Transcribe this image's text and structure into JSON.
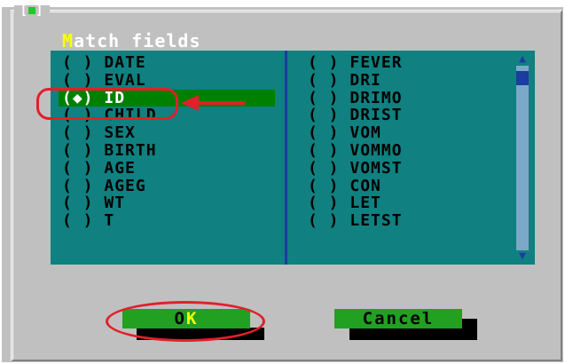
{
  "dialog": {
    "close_box_left": "[",
    "close_box_right": "]",
    "title_hotkey": "M",
    "title_rest": "atch fields"
  },
  "fields_left": [
    {
      "marker": "( )",
      "name": "DATE",
      "selected": false
    },
    {
      "marker": "( )",
      "name": "EVAL",
      "selected": false
    },
    {
      "marker": "(◆)",
      "name": "ID",
      "selected": true
    },
    {
      "marker": "( )",
      "name": "CHILD",
      "selected": false
    },
    {
      "marker": "( )",
      "name": "SEX",
      "selected": false
    },
    {
      "marker": "( )",
      "name": "BIRTH",
      "selected": false
    },
    {
      "marker": "( )",
      "name": "AGE",
      "selected": false
    },
    {
      "marker": "( )",
      "name": "AGEG",
      "selected": false
    },
    {
      "marker": "( )",
      "name": "WT",
      "selected": false
    },
    {
      "marker": "( )",
      "name": "T",
      "selected": false
    }
  ],
  "fields_right": [
    {
      "marker": "( )",
      "name": "FEVER",
      "selected": false
    },
    {
      "marker": "( )",
      "name": "DRI",
      "selected": false
    },
    {
      "marker": "( )",
      "name": "DRIMO",
      "selected": false
    },
    {
      "marker": "( )",
      "name": "DRIST",
      "selected": false
    },
    {
      "marker": "( )",
      "name": "VOM",
      "selected": false
    },
    {
      "marker": "( )",
      "name": "VOMMO",
      "selected": false
    },
    {
      "marker": "( )",
      "name": "VOMST",
      "selected": false
    },
    {
      "marker": "( )",
      "name": "CON",
      "selected": false
    },
    {
      "marker": "( )",
      "name": "LET",
      "selected": false
    },
    {
      "marker": "( )",
      "name": "LETST",
      "selected": false
    }
  ],
  "scrollbar": {
    "up_arrow": "▲",
    "down_arrow": "▼"
  },
  "buttons": {
    "ok_first": "O",
    "ok_hotkey": "K",
    "cancel_label": "Cancel"
  },
  "colors": {
    "dialog_bg": "#c0c0c0",
    "list_bg": "#108080",
    "selected_bg": "#008000",
    "button_bg": "#22a022",
    "hotkey": "#ffff00",
    "annotation": "#e0202a"
  }
}
